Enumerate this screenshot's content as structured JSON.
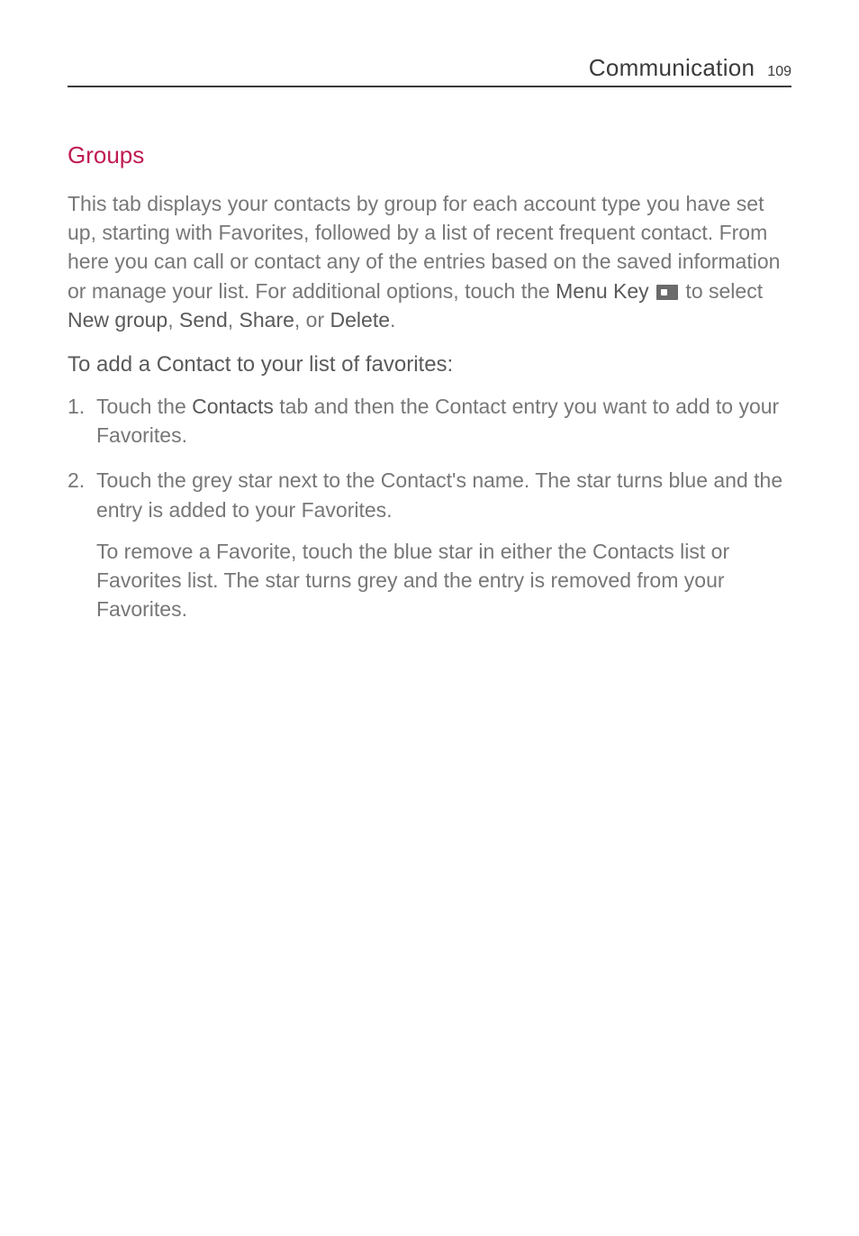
{
  "header": {
    "title": "Communication",
    "page_number": "109"
  },
  "section": {
    "heading": "Groups",
    "intro_parts": {
      "p1": "This tab displays your contacts by group for each account type you have set up, starting with Favorites, followed by a list of recent frequent contact. From here you can call or contact any of the entries based on the saved information or manage your list. For additional options, touch the ",
      "menu_key": "Menu Key",
      "p2": " to select ",
      "opt1": "New group",
      "sep1": ", ",
      "opt2": "Send",
      "sep2": ", ",
      "opt3": "Share",
      "sep3": ", or ",
      "opt4": "Delete",
      "end": "."
    }
  },
  "subsection": {
    "heading": "To add a Contact to your list of favorites:",
    "steps": [
      {
        "pre": "Touch the ",
        "strong": "Contacts",
        "post": " tab and then the Contact entry you want to add to your Favorites."
      },
      {
        "pre": "Touch the grey star next to the Contact's name. The star turns blue and the entry is added to your Favorites.",
        "strong": "",
        "post": ""
      }
    ],
    "tail_para": "To remove a Favorite, touch the blue star in either the Contacts list or Favorites list. The star turns grey and the entry is removed from your Favorites."
  }
}
